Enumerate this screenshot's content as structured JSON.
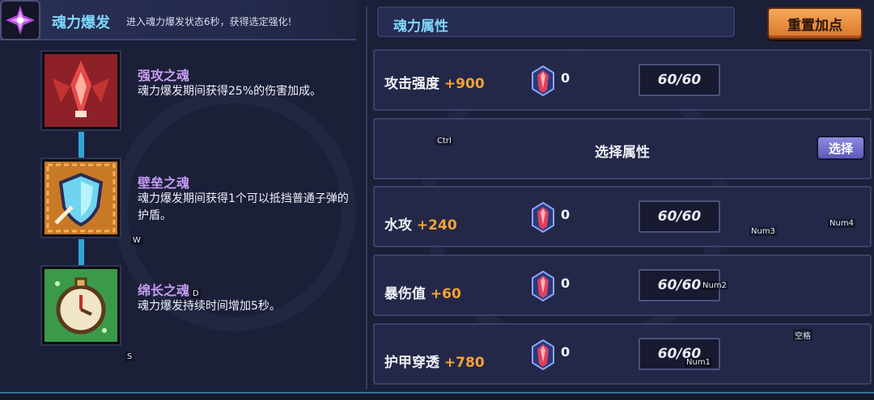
{
  "burst": {
    "title": "魂力爆发",
    "desc": "进入魂力爆发状态6秒，获得选定强化!"
  },
  "skills": [
    {
      "name": "强攻之魂",
      "text": "魂力爆发期间获得25%的伤害加成。",
      "icon": "red-claw-icon",
      "color": "#b8292b"
    },
    {
      "name": "壁垒之魂",
      "text": "魂力爆发期间获得1个可以抵挡普通子弹的护盾。",
      "icon": "shield-icon",
      "color": "#d98a2d"
    },
    {
      "name": "绵长之魂",
      "text": "魂力爆发持续时间增加5秒。",
      "icon": "stopwatch-icon",
      "color": "#3cb04f"
    }
  ],
  "attributes": {
    "title": "魂力属性",
    "reset_label": "重置加点",
    "select_label": "选择属性",
    "select_button": "选择",
    "rows": [
      {
        "name": "攻击强度",
        "bonus": "+900",
        "count": "0",
        "cap": "60/60"
      },
      {
        "name": "水攻",
        "bonus": "+240",
        "count": "0",
        "cap": "60/60"
      },
      {
        "name": "暴伤值",
        "bonus": "+60",
        "count": "0",
        "cap": "60/60"
      },
      {
        "name": "护甲穿透",
        "bonus": "+780",
        "count": "0",
        "cap": "60/60"
      }
    ]
  },
  "key_hints": {
    "ctrl": "Ctrl",
    "w": "W",
    "d": "D",
    "s": "S",
    "num1": "Num1",
    "num2": "Num2",
    "num3": "Num3",
    "num4": "Num4",
    "space": "空格"
  }
}
